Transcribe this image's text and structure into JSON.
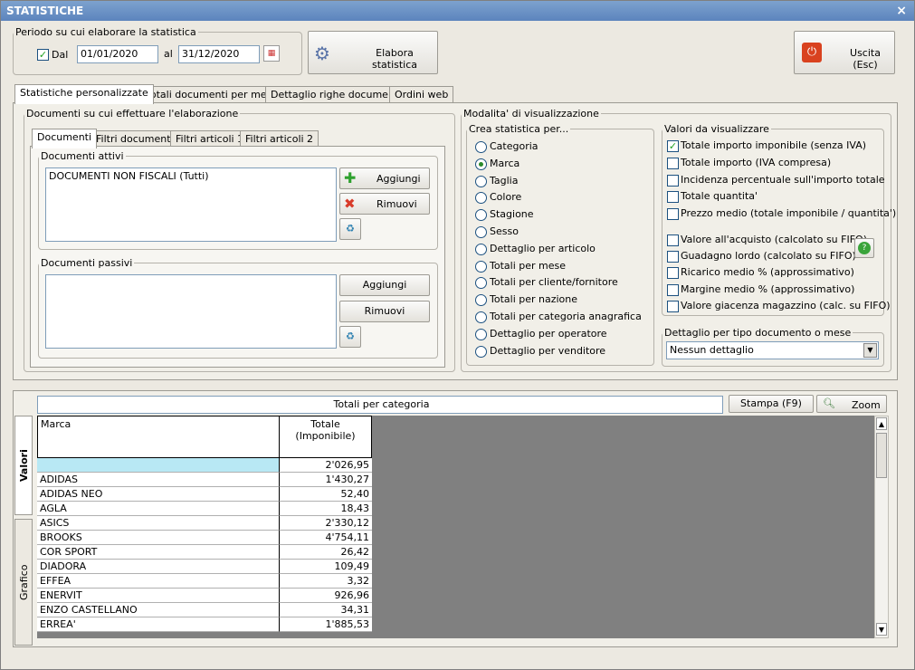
{
  "window": {
    "title": "STATISTICHE",
    "close": "×"
  },
  "period": {
    "legend": "Periodo su cui elaborare la statistica",
    "dal_label": "Dal",
    "dal_checked": true,
    "date_from": "01/01/2020",
    "al_label": "al",
    "date_to": "31/12/2020"
  },
  "toolbar": {
    "elabora": "Elabora statistica",
    "uscita": "Uscita (Esc)"
  },
  "main_tabs": [
    "Statistiche personalizzate",
    "Totali documenti per mese",
    "Dettaglio righe documenti",
    "Ordini web"
  ],
  "docs": {
    "legend": "Documenti su cui effettuare l'elaborazione",
    "sub_tabs": [
      "Documenti",
      "Filtri documenti",
      "Filtri articoli 1",
      "Filtri articoli 2"
    ],
    "attivi": {
      "legend": "Documenti attivi",
      "items": [
        "DOCUMENTI NON FISCALI (Tutti)"
      ],
      "add": "Aggiungi",
      "remove": "Rimuovi"
    },
    "passivi": {
      "legend": "Documenti passivi",
      "add": "Aggiungi",
      "remove": "Rimuovi"
    }
  },
  "modalita": {
    "legend": "Modalita' di visualizzazione",
    "crea": {
      "legend": "Crea statistica per...",
      "options": [
        "Categoria",
        "Marca",
        "Taglia",
        "Colore",
        "Stagione",
        "Sesso",
        "Dettaglio per articolo",
        "Totali per mese",
        "Totali per cliente/fornitore",
        "Totali per nazione",
        "Totali per categoria anagrafica",
        "Dettaglio per operatore",
        "Dettaglio per venditore"
      ],
      "selected": "Marca"
    },
    "valori": {
      "legend": "Valori da visualizzare",
      "options": [
        {
          "label": "Totale importo imponibile (senza IVA)",
          "checked": true
        },
        {
          "label": "Totale importo (IVA compresa)",
          "checked": false
        },
        {
          "label": "Incidenza percentuale sull'importo totale",
          "checked": false
        },
        {
          "label": "Totale quantita'",
          "checked": false
        },
        {
          "label": "Prezzo medio (totale imponibile / quantita')",
          "checked": false
        },
        {
          "label": "Valore all'acquisto (calcolato su FIFO)",
          "checked": false
        },
        {
          "label": "Guadagno lordo (calcolato su FIFO)",
          "checked": false
        },
        {
          "label": "Ricarico medio % (approssimativo)",
          "checked": false
        },
        {
          "label": "Margine medio % (approssimativo)",
          "checked": false
        },
        {
          "label": "Valore giacenza magazzino (calc. su FIFO)",
          "checked": false
        }
      ]
    },
    "dettaglio": {
      "legend": "Dettaglio per tipo documento o mese",
      "value": "Nessun dettaglio"
    }
  },
  "results": {
    "title": "Totali per categoria",
    "stampa": "Stampa (F9)",
    "zoom": "Zoom",
    "vtab_valori": "Valori",
    "vtab_grafico": "Grafico",
    "col1": "Marca",
    "col2": "Totale (Imponibile)",
    "rows": [
      [
        "",
        "2'026,95"
      ],
      [
        "ADIDAS",
        "1'430,27"
      ],
      [
        "ADIDAS NEO",
        "52,40"
      ],
      [
        "AGLA",
        "18,43"
      ],
      [
        "ASICS",
        "2'330,12"
      ],
      [
        "BROOKS",
        "4'754,11"
      ],
      [
        "COR SPORT",
        "26,42"
      ],
      [
        "DIADORA",
        "109,49"
      ],
      [
        "EFFEA",
        "3,32"
      ],
      [
        "ENERVIT",
        "926,96"
      ],
      [
        "ENZO CASTELLANO",
        "34,31"
      ],
      [
        "ERREA'",
        "1'885,53"
      ]
    ]
  }
}
